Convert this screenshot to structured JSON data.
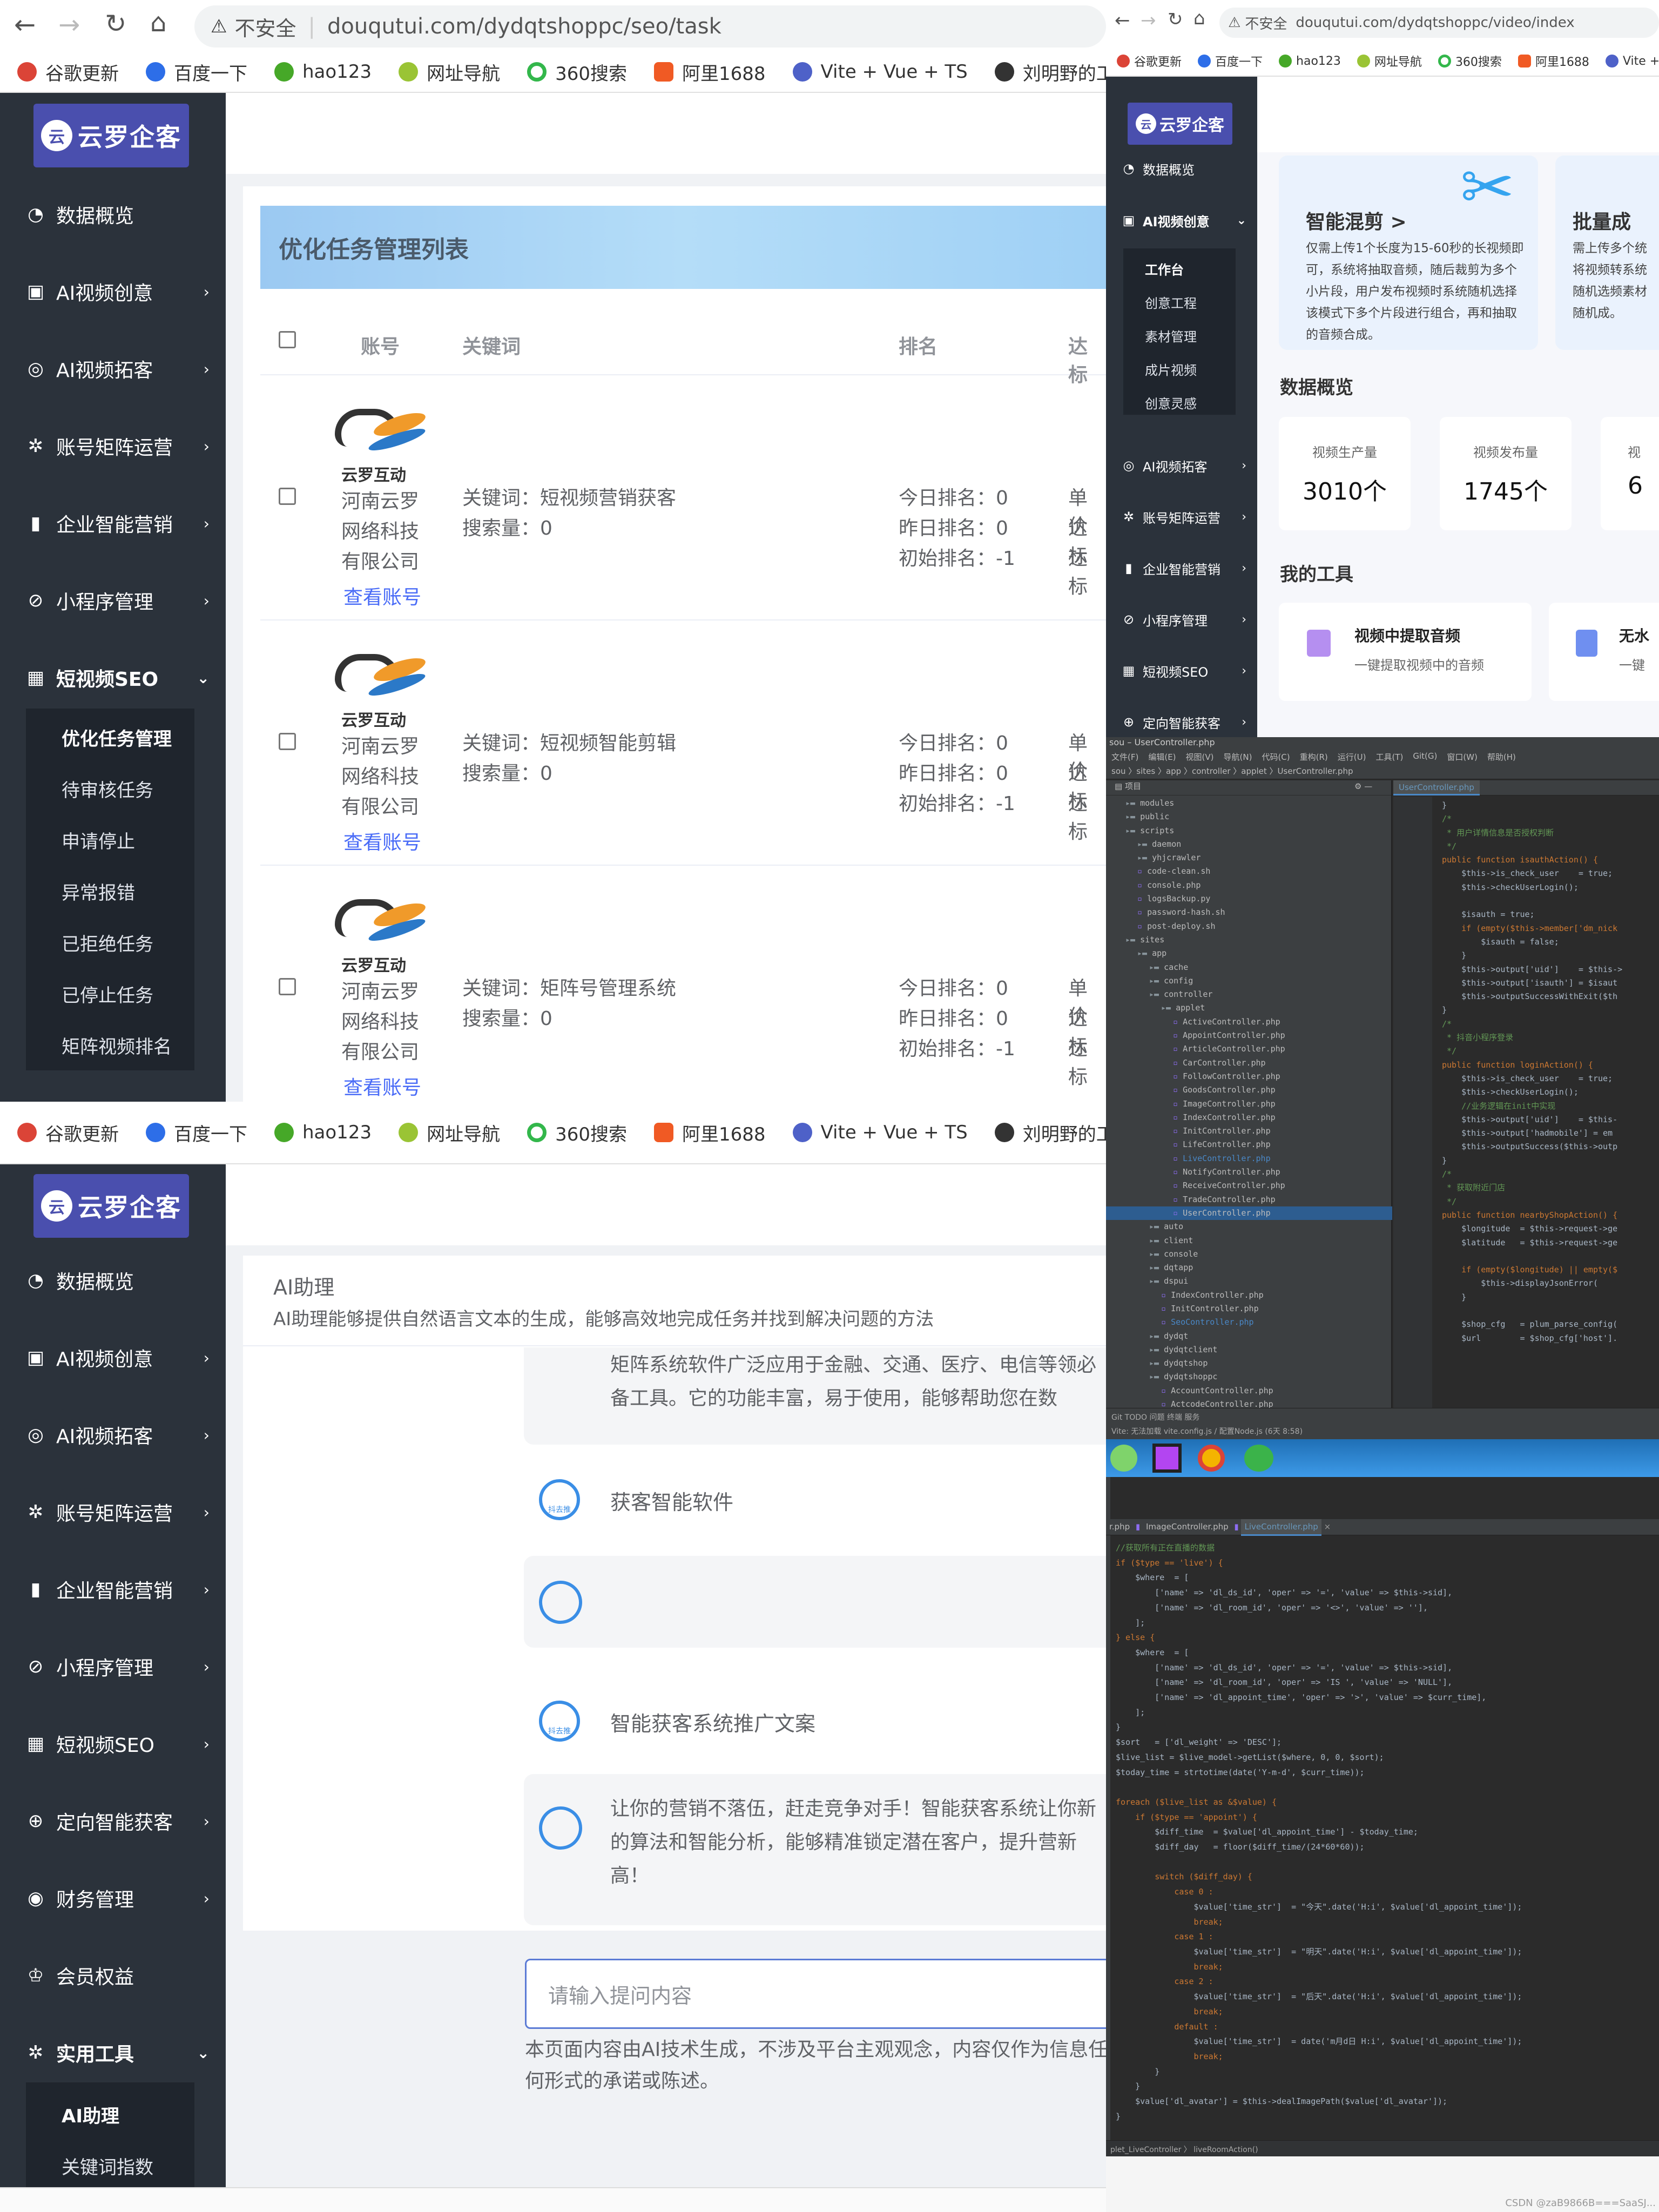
{
  "browser": {
    "security_label": "不安全",
    "url_seo_task": "douqutui.com/dydqtshoppc/seo/task",
    "url_video_index": "douqutui.com/dydqtshoppc/video/index",
    "bookmarks": [
      "谷歌更新",
      "百度一下",
      "hao123",
      "网址导航",
      "360搜索",
      "阿里1688",
      "Vite + Vue + TS",
      "刘明野的工具箱"
    ]
  },
  "logo": {
    "text": "云罗企客",
    "mark": "云"
  },
  "sidebar_top": {
    "items": [
      "数据概览",
      "AI视频创意",
      "AI视频拓客",
      "账号矩阵运营",
      "企业智能营销",
      "小程序管理",
      "短视频SEO"
    ],
    "sub_items": [
      "优化任务管理",
      "待审核任务",
      "申请停止",
      "异常报错",
      "已拒绝任务",
      "已停止任务",
      "矩阵视频排名"
    ]
  },
  "seo_task": {
    "title": "优化任务管理列表",
    "columns": [
      "账号",
      "关键词",
      "排名",
      "达标"
    ],
    "rows": [
      {
        "brand": "云罗互动",
        "company": "河南云罗网络科技有限公司",
        "link": "查看账号",
        "keyword": "关键词：短视频营销获客",
        "search": "搜索量：0",
        "today": "今日排名：0",
        "yesterday": "昨日排名：0",
        "initial": "初始排名：-1",
        "c1": "单价",
        "c2": "达标",
        "c3": "达标"
      },
      {
        "brand": "云罗互动",
        "company": "河南云罗网络科技有限公司",
        "link": "查看账号",
        "keyword": "关键词：短视频智能剪辑",
        "search": "搜索量：0",
        "today": "今日排名：0",
        "yesterday": "昨日排名：0",
        "initial": "初始排名：-1",
        "c1": "单价",
        "c2": "达标",
        "c3": "达标"
      },
      {
        "brand": "云罗互动",
        "company": "河南云罗网络科技有限公司",
        "link": "查看账号",
        "keyword": "关键词：矩阵号管理系统",
        "search": "搜索量：0",
        "today": "今日排名：0",
        "yesterday": "昨日排名：0",
        "initial": "初始排名：-1",
        "c1": "单价",
        "c2": "达标",
        "c3": "达标"
      }
    ]
  },
  "sidebar_bottom": {
    "items": [
      "数据概览",
      "AI视频创意",
      "AI视频拓客",
      "账号矩阵运营",
      "企业智能营销",
      "小程序管理",
      "短视频SEO",
      "定向智能获客",
      "财务管理",
      "会员权益",
      "实用工具"
    ],
    "sub_items": [
      "AI助理",
      "关键词指数"
    ]
  },
  "ai_assistant": {
    "title": "AI助理",
    "desc": "AI助理能够提供自然语言文本的生成，能够高效地完成任务并找到解决问题的方法",
    "top_text": "矩阵系统软件广泛应用于金融、交通、医疗、电信等领必备工具。它的功能丰富，易于使用，能够帮助您在数",
    "prompt1": "获客智能软件",
    "prompt2": "智能获客系统推广文案",
    "bot_icon_label": "抖去推",
    "answer": "让你的营销不落伍，赶走竞争对手！智能获客系统让你新的算法和智能分析，能够精准锁定潜在客户，提升营新高！",
    "input_placeholder": "请输入提问内容",
    "disclaimer": "本页面内容由AI技术生成，不涉及平台主观观念，内容仅作为信息任何形式的承诺或陈述。"
  },
  "video_page": {
    "sidebar": {
      "items": [
        "数据概览",
        "AI视频创意",
        "AI视频拓客",
        "账号矩阵运营",
        "企业智能营销",
        "小程序管理",
        "短视频SEO",
        "定向智能获客"
      ],
      "sub_items": [
        "工作台",
        "创意工程",
        "素材管理",
        "成片视频",
        "创意灵感"
      ]
    },
    "card1_title": "智能混剪 >",
    "card1_desc": "仅需上传1个长度为15-60秒的长视频即可，系统将抽取音频，随后裁剪为多个小片段，用户发布视频时系统随机选择该模式下多个片段进行组合，再和抽取的音频合成。",
    "card2_title": "批量成",
    "card2_desc": "需上传多个统将视频转系统随机选频素材随机成。",
    "overview_title": "数据概览",
    "stats": [
      {
        "label": "视频生产量",
        "value": "3010个"
      },
      {
        "label": "视频发布量",
        "value": "1745个"
      },
      {
        "label": "视",
        "value": "6"
      }
    ],
    "tools_title": "我的工具",
    "tool1_title": "视频中提取音频",
    "tool1_desc": "一键提取视频中的音频",
    "tool2_title": "无水",
    "tool2_desc": "一键"
  },
  "ide1": {
    "title": "sou – UserController.php",
    "menu": [
      "文件(F)",
      "编辑(E)",
      "视图(V)",
      "导航(N)",
      "代码(C)",
      "重构(R)",
      "运行(U)",
      "工具(T)",
      "Git(G)",
      "窗口(W)",
      "帮助(H)"
    ],
    "breadcrumb": "sou 〉sites 〉app 〉controller 〉applet 〉UserController.php",
    "project_label": "项目",
    "tab": "UserController.php",
    "tree": [
      "modules",
      "public",
      "scripts",
      "daemon",
      "yhjcrawler",
      "code-clean.sh",
      "console.php",
      "logsBackup.py",
      "password-hash.sh",
      "post-deploy.sh",
      "sites",
      "app",
      "cache",
      "config",
      "controller",
      "applet",
      "ActiveController.php",
      "AppointController.php",
      "ArticleController.php",
      "CarController.php",
      "FollowController.php",
      "GoodsController.php",
      "ImageController.php",
      "IndexController.php",
      "InitController.php",
      "LifeController.php",
      "LiveController.php",
      "NotifyController.php",
      "ReceiveController.php",
      "TradeController.php",
      "UserController.php",
      "auto",
      "client",
      "console",
      "dqtapp",
      "dspui",
      "IndexController.php",
      "InitController.php",
      "SeoController.php",
      "dydqt",
      "dydqtclient",
      "dydqtshop",
      "dydqtshoppc",
      "AccountController.php",
      "ActcodeController.php"
    ],
    "code": [
      "}",
      "/*",
      " * 用户详情信息是否授权判断",
      " */",
      "public function isauthAction() {",
      "    $this->is_check_user    = true;",
      "    $this->checkUserLogin();",
      "",
      "    $isauth = true;",
      "    if (empty($this->member['dm_nick",
      "        $isauth = false;",
      "    }",
      "    $this->output['uid']    = $this->",
      "    $this->output['isauth'] = $isaut",
      "    $this->outputSuccessWithExit($th",
      "}",
      "/*",
      " * 抖音小程序登录",
      " */",
      "public function loginAction() {",
      "    $this->is_check_user    = true;",
      "    $this->checkUserLogin();",
      "    //业务逻辑在init中实现",
      "    $this->output['uid']    = $this-",
      "    $this->output['hadmobile'] = em",
      "    $this->outputSuccess($this->outp",
      "}",
      "/*",
      " * 获取附近门店",
      " */",
      "public function nearbyShopAction() {",
      "    $longitude  = $this->request->ge",
      "    $latitude   = $this->request->ge",
      "",
      "    if (empty($longitude) || empty($",
      "        $this->displayJsonError(",
      "    }",
      "",
      "    $shop_cfg   = plum_parse_config(",
      "    $url        = $shop_cfg['host']."
    ],
    "status": "Git   TODO   问题   终端   服务",
    "status2": "Vite: 无法加载 vite.config.js / 配置Node.js (6天 8:58)"
  },
  "ide2": {
    "tabs": [
      "r.php",
      "ImageController.php",
      "LiveController.php"
    ],
    "code": [
      "//获取所有正在直播的数据",
      "if ($type == 'live') {",
      "    $where  = [",
      "        ['name' => 'dl_ds_id', 'oper' => '=', 'value' => $this->sid],",
      "        ['name' => 'dl_room_id', 'oper' => '<>', 'value' => ''],",
      "    ];",
      "} else {",
      "    $where  = [",
      "        ['name' => 'dl_ds_id', 'oper' => '=', 'value' => $this->sid],",
      "        ['name' => 'dl_room_id', 'oper' => 'IS ', 'value' => 'NULL'],",
      "        ['name' => 'dl_appoint_time', 'oper' => '>', 'value' => $curr_time],",
      "    ];",
      "}",
      "$sort   = ['dl_weight' => 'DESC'];",
      "$live_list = $live_model->getList($where, 0, 0, $sort);",
      "$today_time = strtotime(date('Y-m-d', $curr_time));",
      "",
      "foreach ($live_list as &$value) {",
      "    if ($type == 'appoint') {",
      "        $diff_time  = $value['dl_appoint_time'] - $today_time;",
      "        $diff_day   = floor($diff_time/(24*60*60));",
      "",
      "        switch ($diff_day) {",
      "            case 0 :",
      "                $value['time_str']  = \"今天\".date('H:i', $value['dl_appoint_time']);",
      "                break;",
      "            case 1 :",
      "                $value['time_str']  = \"明天\".date('H:i', $value['dl_appoint_time']);",
      "                break;",
      "            case 2 :",
      "                $value['time_str']  = \"后天\".date('H:i', $value['dl_appoint_time']);",
      "                break;",
      "            default :",
      "                $value['time_str']  = date('m月d日 H:i', $value['dl_appoint_time']);",
      "                break;",
      "        }",
      "    }",
      "    $value['dl_avatar'] = $this->dealImagePath($value['dl_avatar']);",
      "}"
    ],
    "footer": "plet_LiveController 〉 liveRoomAction()",
    "watermark": "CSDN @zaB9866B===SaaSJ..."
  }
}
